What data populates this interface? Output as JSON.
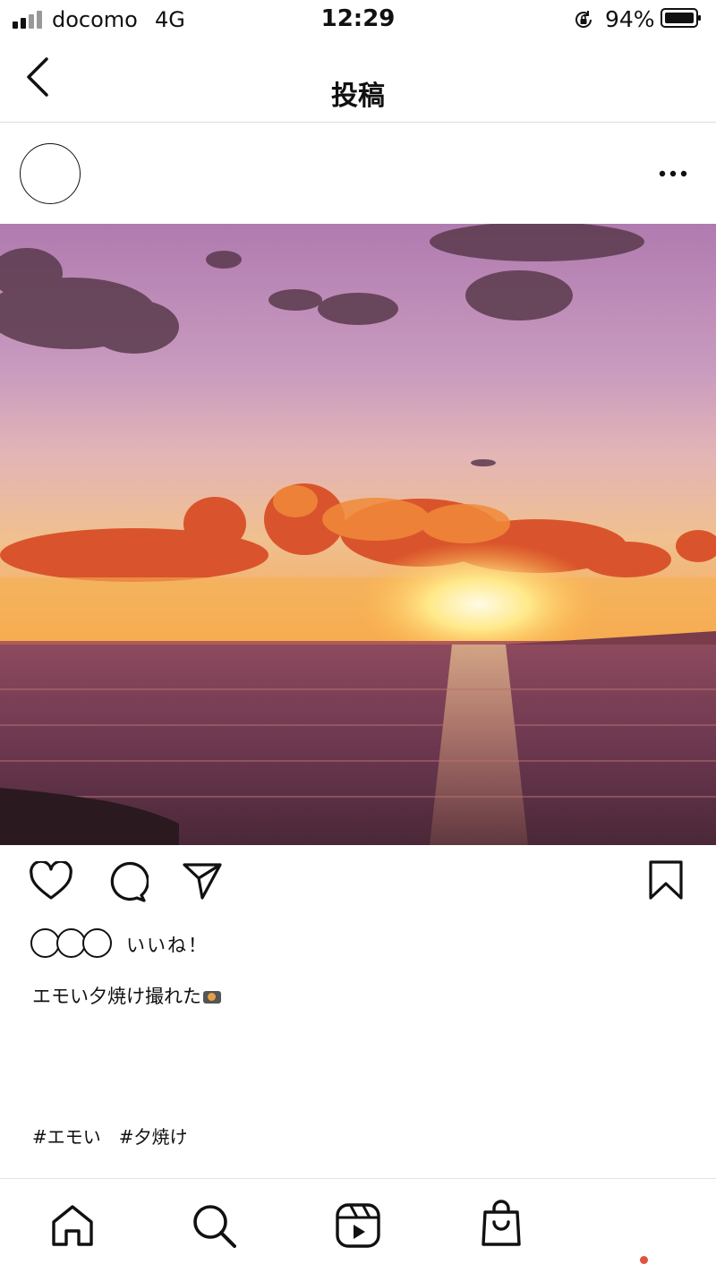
{
  "status_bar": {
    "carrier": "docomo",
    "network": "4G",
    "time": "12:29",
    "battery": "94%",
    "battery_level": 0.94
  },
  "nav": {
    "title": "投稿",
    "back_icon": "chevron-left-icon"
  },
  "post": {
    "more_icon": "more-horizontal-icon",
    "image": "sunset-over-sea",
    "actions": {
      "like_icon": "heart-icon",
      "comment_icon": "comment-icon",
      "share_icon": "send-icon",
      "save_icon": "bookmark-icon"
    },
    "likes_text": "いいね！",
    "caption": "エモい夕焼け撮れた",
    "caption_emoji": "camera-flash-icon",
    "hashtags": [
      "#エモい",
      "#夕焼け"
    ]
  },
  "tab_bar": {
    "items": [
      "home-icon",
      "search-icon",
      "reels-icon",
      "shop-icon",
      "profile-icon"
    ],
    "notification_color": "#e0533f"
  }
}
